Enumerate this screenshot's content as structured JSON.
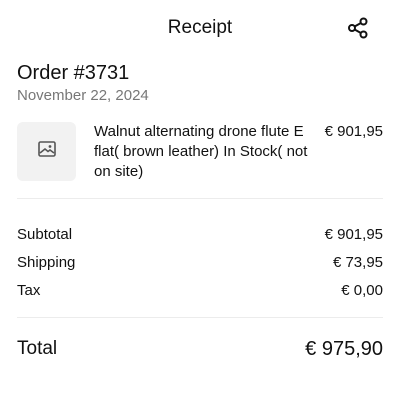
{
  "header": {
    "title": "Receipt",
    "share_icon": "share-icon"
  },
  "order": {
    "title": "Order #3731",
    "date": "November 22, 2024"
  },
  "items": [
    {
      "thumbnail_icon": "image-placeholder-icon",
      "name": "Walnut alternating drone flute E flat( brown leather) In Stock( not on site)",
      "price": "€ 901,95"
    }
  ],
  "summary": {
    "subtotal_label": "Subtotal",
    "subtotal_value": "€ 901,95",
    "shipping_label": "Shipping",
    "shipping_value": "€ 73,95",
    "tax_label": "Tax",
    "tax_value": "€ 0,00",
    "total_label": "Total",
    "total_value": "€ 975,90"
  },
  "colors": {
    "text": "#111111",
    "muted": "#777777",
    "thumb_bg": "#f2f2f2",
    "divider": "#ececec"
  }
}
